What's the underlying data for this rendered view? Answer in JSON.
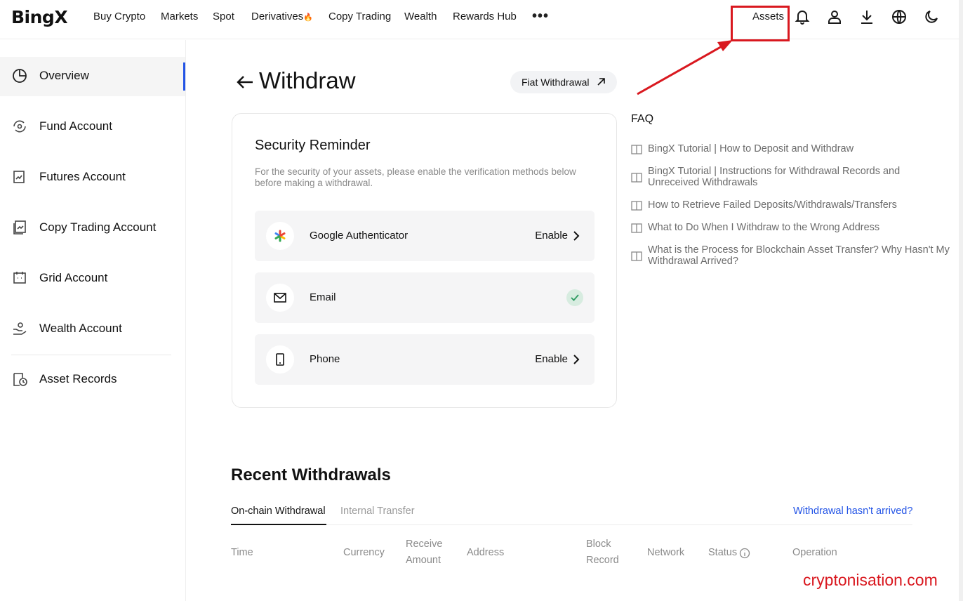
{
  "brand": {
    "logo": "BingX",
    "accent": "#2354e6",
    "annotation_color": "#d9181f"
  },
  "topnav": {
    "items": [
      "Buy Crypto",
      "Markets",
      "Spot",
      "Derivatives",
      "Copy Trading",
      "Wealth",
      "Rewards Hub"
    ],
    "derivatives_badge": "🔥",
    "more": "•••",
    "assets": "Assets",
    "icons": [
      "bell-icon",
      "user-icon",
      "download-icon",
      "globe-icon",
      "moon-icon"
    ]
  },
  "sidebar": {
    "items": [
      {
        "label": "Overview",
        "icon": "pie-chart-icon",
        "active": true
      },
      {
        "label": "Fund Account",
        "icon": "fund-icon",
        "active": false
      },
      {
        "label": "Futures Account",
        "icon": "futures-icon",
        "active": false
      },
      {
        "label": "Copy Trading Account",
        "icon": "copy-trading-icon",
        "active": false
      },
      {
        "label": "Grid Account",
        "icon": "grid-icon",
        "active": false
      },
      {
        "label": "Wealth Account",
        "icon": "wealth-icon",
        "active": false
      },
      {
        "label": "Asset Records",
        "icon": "records-icon",
        "active": false
      }
    ]
  },
  "header": {
    "title": "Withdraw",
    "fiat_button": "Fiat Withdrawal"
  },
  "security": {
    "title": "Security Reminder",
    "description": "For the security of your assets, please enable the verification methods below before making a withdrawal.",
    "methods": [
      {
        "label": "Google Authenticator",
        "action": "Enable",
        "icon": "google-authenticator-icon",
        "enabled": false
      },
      {
        "label": "Email",
        "action": "",
        "icon": "mail-icon",
        "enabled": true
      },
      {
        "label": "Phone",
        "action": "Enable",
        "icon": "phone-icon",
        "enabled": false
      }
    ]
  },
  "faq": {
    "title": "FAQ",
    "items": [
      "BingX Tutorial | How to Deposit and Withdraw",
      "BingX Tutorial | Instructions for Withdrawal Records and Unreceived Withdrawals",
      "How to Retrieve Failed Deposits/Withdrawals/Transfers",
      "What to Do When I Withdraw to the Wrong Address",
      "What is the Process for Blockchain Asset Transfer? Why Hasn't My Withdrawal Arrived?"
    ]
  },
  "recent": {
    "title": "Recent Withdrawals",
    "tabs": [
      "On-chain Withdrawal",
      "Internal Transfer"
    ],
    "help_link": "Withdrawal hasn't arrived?",
    "columns": [
      "Time",
      "Currency",
      "Receive Amount",
      "Address",
      "Block Record",
      "Network",
      "Status",
      "Operation"
    ]
  },
  "watermark": "cryptonisation.com"
}
